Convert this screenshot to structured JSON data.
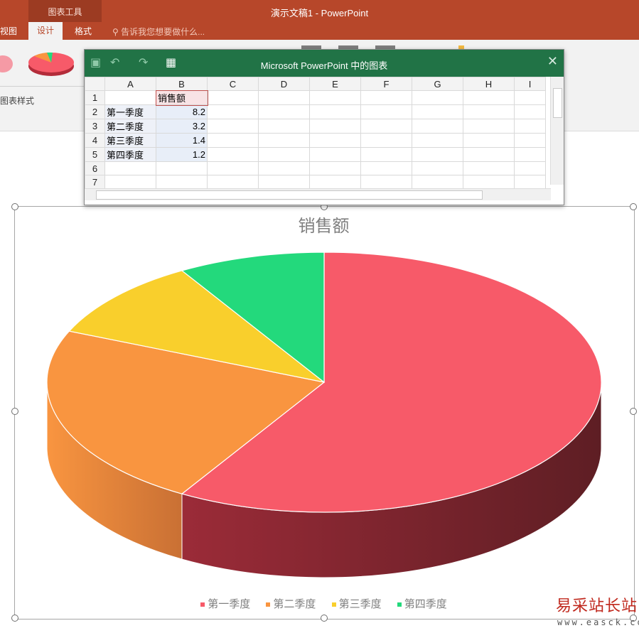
{
  "app": {
    "title": "演示文稿1 - PowerPoint",
    "context_tab_label": "图表工具",
    "tabs": [
      {
        "label": "视图"
      },
      {
        "label": "设计"
      },
      {
        "label": "格式"
      }
    ],
    "tell_me_placeholder": "告诉我您想要做什么...",
    "ribbon_group_label": "图表样式"
  },
  "sheet": {
    "title": "Microsoft PowerPoint 中的图表",
    "columns": [
      "A",
      "B",
      "C",
      "D",
      "E",
      "F",
      "G",
      "H",
      "I"
    ],
    "row_numbers": [
      "1",
      "2",
      "3",
      "4",
      "5",
      "6",
      "7"
    ],
    "header_b": "销售额",
    "rows": [
      {
        "a": "第一季度",
        "b": "8.2"
      },
      {
        "a": "第二季度",
        "b": "3.2"
      },
      {
        "a": "第三季度",
        "b": "1.4"
      },
      {
        "a": "第四季度",
        "b": "1.2"
      }
    ]
  },
  "chart_data": {
    "type": "pie",
    "title": "销售额",
    "categories": [
      "第一季度",
      "第二季度",
      "第三季度",
      "第四季度"
    ],
    "values": [
      8.2,
      3.2,
      1.4,
      1.2
    ],
    "colors": [
      "#f75a69",
      "#f99540",
      "#f9cf2c",
      "#23d97c"
    ],
    "side_colors": [
      "#9b2b38",
      "#c97034",
      "#c79a1e",
      "#19a55e"
    ],
    "legend_position": "bottom",
    "style": "3d"
  },
  "watermark": {
    "text": "易采站长站",
    "url": "www.easck.com"
  }
}
